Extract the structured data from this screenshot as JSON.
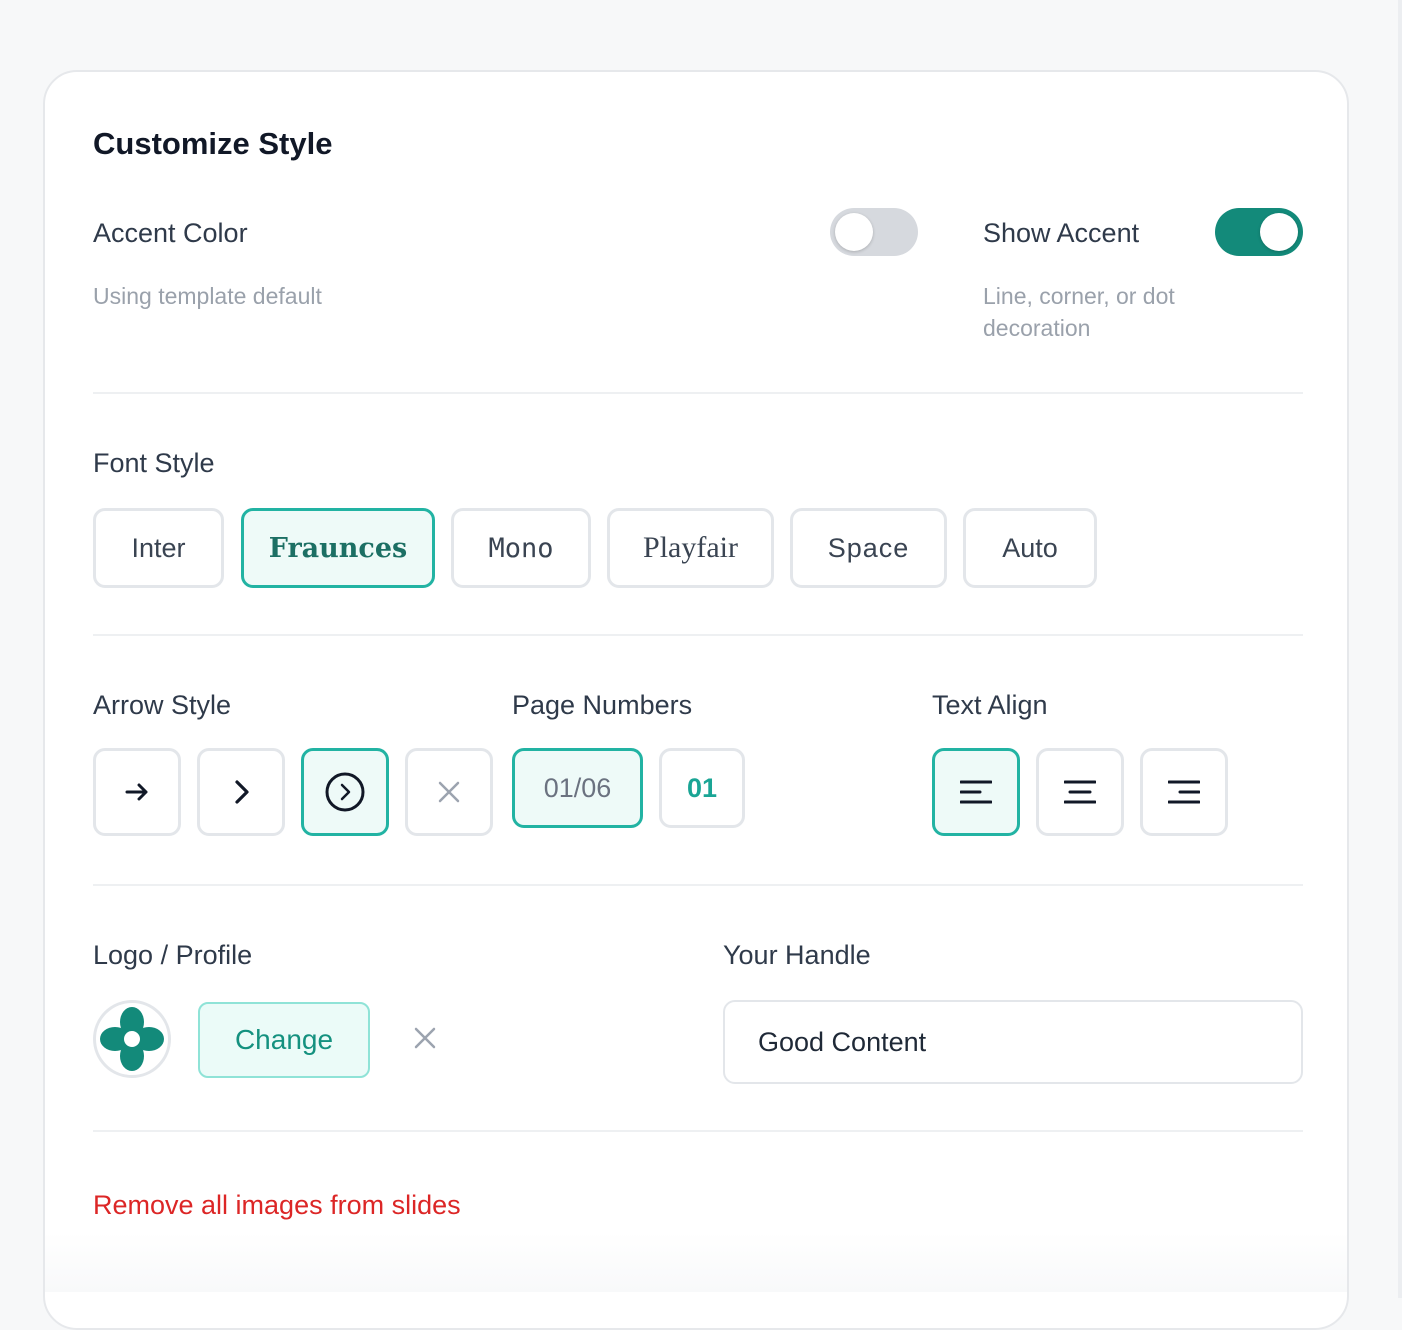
{
  "panel": {
    "title": "Customize Style"
  },
  "accent_color": {
    "label": "Accent Color",
    "description": "Using template default",
    "enabled": false
  },
  "show_accent": {
    "label": "Show Accent",
    "description_line1": "Line, corner, or dot",
    "description_line2": "decoration",
    "enabled": true
  },
  "font_style": {
    "label": "Font Style",
    "options": [
      "Inter",
      "Fraunces",
      "Mono",
      "Playfair",
      "Space",
      "Auto"
    ],
    "selected": "Fraunces"
  },
  "arrow_style": {
    "label": "Arrow Style",
    "options": [
      "arrow-right-icon",
      "chevron-right-icon",
      "circle-chevron-right-icon",
      "close-icon"
    ],
    "selected": "circle-chevron-right-icon"
  },
  "page_numbers": {
    "label": "Page Numbers",
    "options": [
      "01/06",
      "01"
    ],
    "selected": "01/06"
  },
  "text_align": {
    "label": "Text Align",
    "options": [
      "align-left-icon",
      "align-center-icon",
      "align-right-icon"
    ],
    "selected": "align-left-icon"
  },
  "logo": {
    "label": "Logo / Profile",
    "change_label": "Change"
  },
  "handle": {
    "label": "Your Handle",
    "value": "Good Content"
  },
  "remove_images_label": "Remove all images from slides",
  "colors": {
    "accent": "#138a7a",
    "selected_border": "#22b3a3",
    "danger": "#dc2626"
  }
}
